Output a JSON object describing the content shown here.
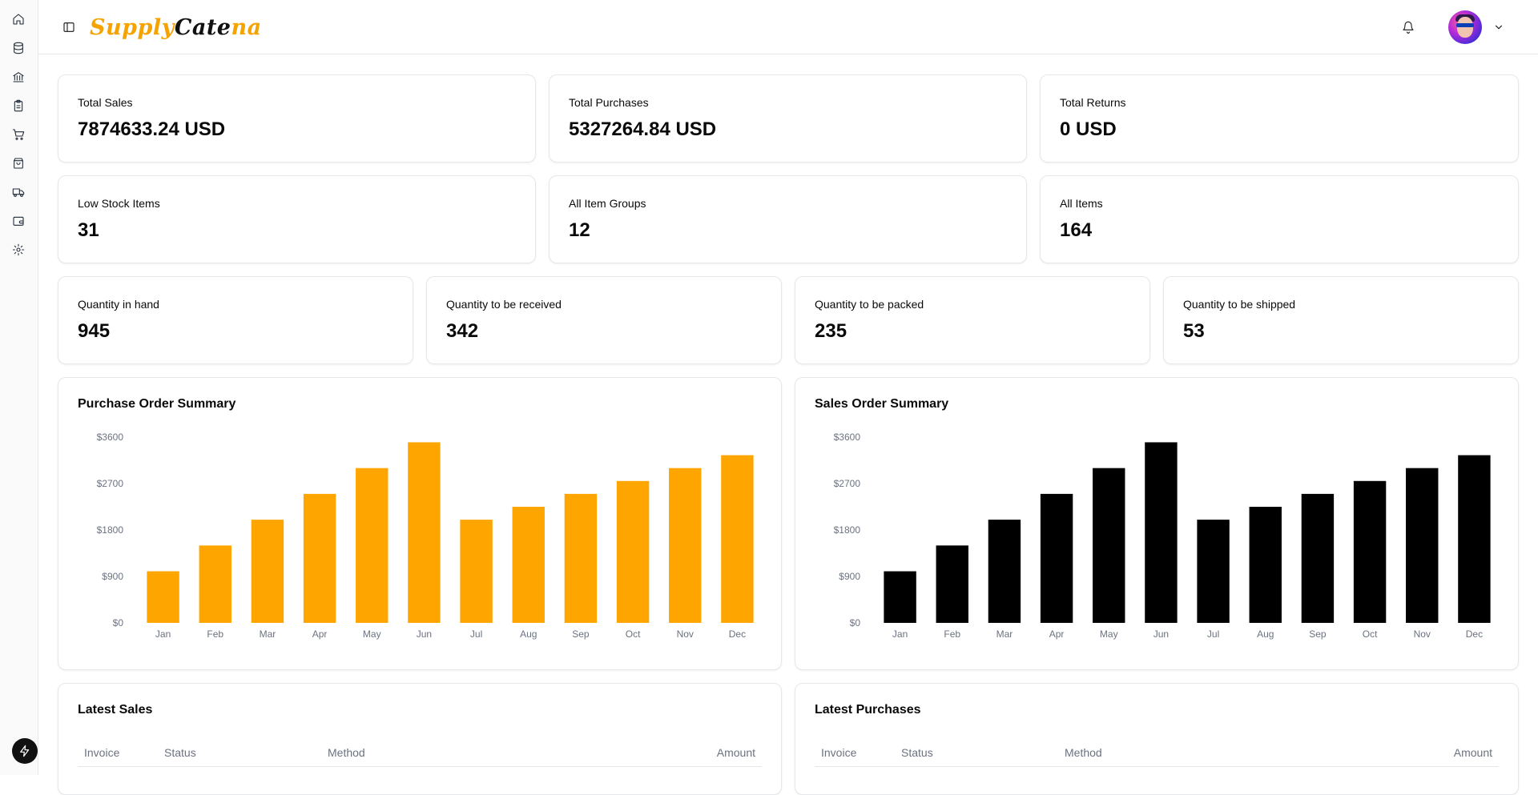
{
  "app": {
    "logo_part1": "Supply",
    "logo_part2": " Cate",
    "logo_part3": "na"
  },
  "sidebar": {
    "icons": [
      "home-icon",
      "database-icon",
      "bank-icon",
      "clipboard-icon",
      "cart-icon",
      "package-icon",
      "truck-icon",
      "wallet-icon",
      "settings-icon"
    ],
    "bottom_icon": "bolt-icon"
  },
  "stats_row1": [
    {
      "label": "Total Sales",
      "value": "7874633.24 USD"
    },
    {
      "label": "Total Purchases",
      "value": "5327264.84 USD"
    },
    {
      "label": "Total Returns",
      "value": "0 USD"
    }
  ],
  "stats_row2": [
    {
      "label": "Low Stock Items",
      "value": "31"
    },
    {
      "label": "All Item Groups",
      "value": "12"
    },
    {
      "label": "All Items",
      "value": "164"
    }
  ],
  "stats_row3": [
    {
      "label": "Quantity in hand",
      "value": "945"
    },
    {
      "label": "Quantity to be received",
      "value": "342"
    },
    {
      "label": "Quantity to be packed",
      "value": "235"
    },
    {
      "label": "Quantity to be shipped",
      "value": "53"
    }
  ],
  "chart_data": [
    {
      "type": "bar",
      "title": "Purchase Order Summary",
      "color": "#ffa500",
      "categories": [
        "Jan",
        "Feb",
        "Mar",
        "Apr",
        "May",
        "Jun",
        "Jul",
        "Aug",
        "Sep",
        "Oct",
        "Nov",
        "Dec"
      ],
      "values": [
        1000,
        1500,
        2000,
        2500,
        3000,
        3500,
        2000,
        2250,
        2500,
        2750,
        3000,
        3250
      ],
      "y_ticks": [
        "$0",
        "$900",
        "$1800",
        "$2700",
        "$3600"
      ],
      "ylim": [
        0,
        3600
      ],
      "grid": false
    },
    {
      "type": "bar",
      "title": "Sales Order Summary",
      "color": "#000000",
      "categories": [
        "Jan",
        "Feb",
        "Mar",
        "Apr",
        "May",
        "Jun",
        "Jul",
        "Aug",
        "Sep",
        "Oct",
        "Nov",
        "Dec"
      ],
      "values": [
        1000,
        1500,
        2000,
        2500,
        3000,
        3500,
        2000,
        2250,
        2500,
        2750,
        3000,
        3250
      ],
      "y_ticks": [
        "$0",
        "$900",
        "$1800",
        "$2700",
        "$3600"
      ],
      "ylim": [
        0,
        3600
      ],
      "grid": false
    }
  ],
  "latest_sales": {
    "title": "Latest Sales",
    "columns": [
      "Invoice",
      "Status",
      "Method",
      "Amount"
    ]
  },
  "latest_purchases": {
    "title": "Latest Purchases",
    "columns": [
      "Invoice",
      "Status",
      "Method",
      "Amount"
    ]
  }
}
